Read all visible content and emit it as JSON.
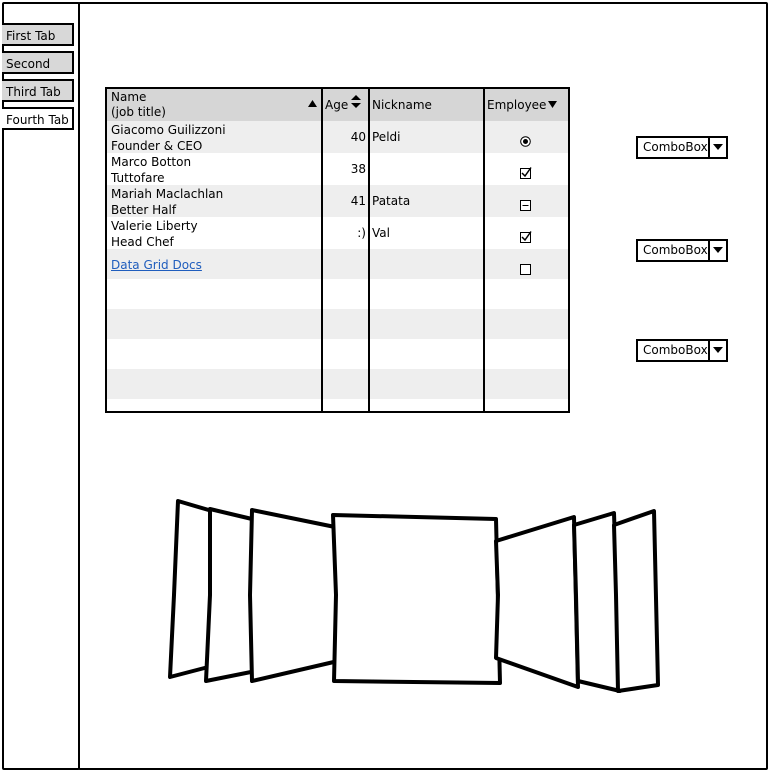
{
  "tabs": [
    {
      "label": "First Tab",
      "active": true
    },
    {
      "label": "Second Tab",
      "active": true
    },
    {
      "label": "Third Tab",
      "active": true
    },
    {
      "label": "Fourth Tab",
      "active": false
    }
  ],
  "grid": {
    "headers": {
      "name": "Name",
      "name_sub": "(job title)",
      "age": "Age",
      "nickname": "Nickname",
      "employee": "Employee"
    },
    "rows": [
      {
        "name": "Giacomo Guilizzoni",
        "title": "Founder & CEO",
        "age": "40",
        "nickname": "Peldi",
        "employee": "radio"
      },
      {
        "name": "Marco Botton",
        "title": "Tuttofare",
        "age": "38",
        "nickname": "",
        "employee": "checked"
      },
      {
        "name": "Mariah Maclachlan",
        "title": "Better Half",
        "age": "41",
        "nickname": "Patata",
        "employee": "indeterminate"
      },
      {
        "name": "Valerie Liberty",
        "title": "Head Chef",
        "age": ":)",
        "nickname": "Val",
        "employee": "checked"
      }
    ],
    "link": {
      "label": "Data Grid Docs",
      "employee": "unchecked"
    }
  },
  "combos": [
    {
      "value": "ComboBox"
    },
    {
      "value": "ComboBox"
    },
    {
      "value": "ComboBox"
    }
  ],
  "icons": {
    "sort_asc": "triangle-up-icon",
    "sort_both": "sort-updown-icon",
    "sort_desc": "triangle-down-icon",
    "dropdown": "chevron-down-icon"
  }
}
